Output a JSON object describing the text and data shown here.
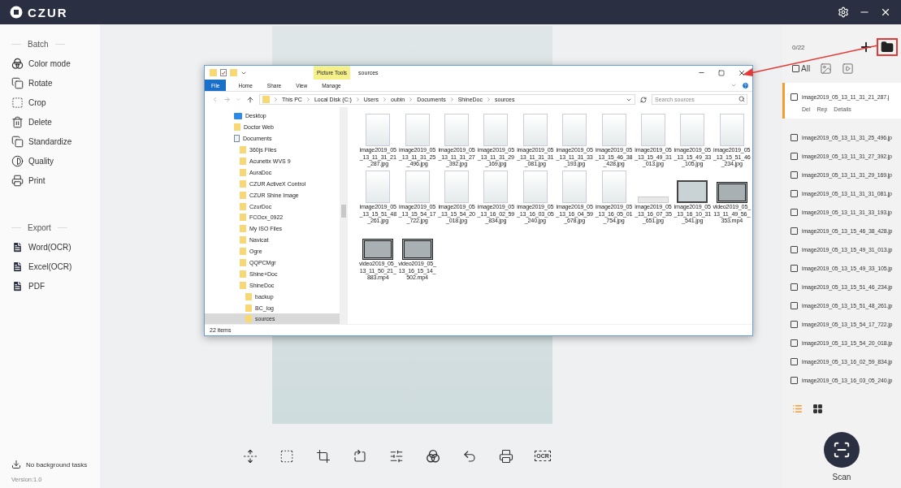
{
  "app": {
    "logo": "CZUR"
  },
  "sidebar": {
    "sections": [
      {
        "title": "Batch",
        "items": [
          {
            "kind": "color",
            "label": "Color mode"
          },
          {
            "kind": "rotate",
            "label": "Rotate"
          },
          {
            "kind": "crop",
            "label": "Crop"
          },
          {
            "kind": "delete",
            "label": "Delete"
          },
          {
            "kind": "standardize",
            "label": "Standardize"
          },
          {
            "kind": "quality",
            "label": "Quality"
          },
          {
            "kind": "print",
            "label": "Print"
          }
        ]
      },
      {
        "title": "Export",
        "items": [
          {
            "kind": "word",
            "label": "Word(OCR)"
          },
          {
            "kind": "excel",
            "label": "Excel(OCR)"
          },
          {
            "kind": "pdf",
            "label": "PDF"
          }
        ]
      }
    ],
    "status": "No background tasks",
    "version": "Version:1.0"
  },
  "toolbar": [
    {
      "kind": "fit"
    },
    {
      "kind": "select"
    },
    {
      "kind": "crop"
    },
    {
      "kind": "rotate"
    },
    {
      "kind": "adjust"
    },
    {
      "kind": "color"
    },
    {
      "kind": "undo"
    },
    {
      "kind": "print"
    },
    {
      "kind": "ocr",
      "label": "OCR"
    }
  ],
  "explorer": {
    "context_tab": "Picture Tools",
    "title": "sources",
    "ribbon": [
      {
        "label": "File",
        "selected": true
      },
      {
        "label": "Home",
        "selected": false
      },
      {
        "label": "Share",
        "selected": false
      },
      {
        "label": "View",
        "selected": false
      },
      {
        "label": "Manage",
        "selected": false
      }
    ],
    "path": [
      "This PC",
      "Local Disk (C:)",
      "Users",
      "oubin",
      "Documents",
      "ShineDoc",
      "sources"
    ],
    "search": {
      "placeholder": "Search sources"
    },
    "tree": [
      {
        "kind": "desktop",
        "label": "Desktop",
        "selected": false
      },
      {
        "kind": "folder",
        "label": "Doctor Web",
        "selected": false
      },
      {
        "kind": "documents",
        "label": "Documents",
        "selected": false,
        "children": [
          {
            "kind": "folder",
            "label": "360js Files",
            "selected": false
          },
          {
            "kind": "folder",
            "label": "Acunetix WVS 9",
            "selected": false
          },
          {
            "kind": "folder",
            "label": "AuraDoc",
            "selected": false
          },
          {
            "kind": "folder",
            "label": "CZUR ActiveX Control",
            "selected": false
          },
          {
            "kind": "folder",
            "label": "CZUR Shine Image",
            "selected": false
          },
          {
            "kind": "folder",
            "label": "CzurDoc",
            "selected": false
          },
          {
            "kind": "folder",
            "label": "FCOcx_0922",
            "selected": false
          },
          {
            "kind": "folder",
            "label": "My ISO Files",
            "selected": false
          },
          {
            "kind": "folder",
            "label": "Navicat",
            "selected": false
          },
          {
            "kind": "folder",
            "label": "Ogre",
            "selected": false
          },
          {
            "kind": "folder",
            "label": "QQPCMgr",
            "selected": false
          },
          {
            "kind": "folder",
            "label": "Shine+Doc",
            "selected": false
          },
          {
            "kind": "folder",
            "label": "ShineDoc",
            "selected": false,
            "children": [
              {
                "kind": "folder",
                "label": "backup",
                "selected": false
              },
              {
                "kind": "folder",
                "label": "BC_log",
                "selected": false
              },
              {
                "kind": "folder",
                "label": "sources",
                "selected": true
              }
            ]
          }
        ]
      }
    ],
    "files": [
      {
        "kind": "image",
        "name": "image2019_05_13_11_31_21_287.jpg"
      },
      {
        "kind": "image",
        "name": "image2019_05_13_11_31_25_496.jpg"
      },
      {
        "kind": "image",
        "name": "image2019_05_13_11_31_27_392.jpg"
      },
      {
        "kind": "image",
        "name": "image2019_05_13_11_31_29_169.jpg"
      },
      {
        "kind": "image",
        "name": "image2019_05_13_11_31_31_081.jpg"
      },
      {
        "kind": "image",
        "name": "image2019_05_13_11_31_33_193.jpg"
      },
      {
        "kind": "image",
        "name": "image2019_05_13_15_46_38_428.jpg"
      },
      {
        "kind": "image",
        "name": "image2019_05_13_15_49_31_013.jpg"
      },
      {
        "kind": "image",
        "name": "image2019_05_13_15_49_33_105.jpg"
      },
      {
        "kind": "image",
        "name": "image2019_05_13_15_51_46_234.jpg"
      },
      {
        "kind": "image",
        "name": "image2019_05_13_15_51_48_261.jpg"
      },
      {
        "kind": "image",
        "name": "image2019_05_13_15_54_17_722.jpg"
      },
      {
        "kind": "image",
        "name": "image2019_05_13_15_54_20_018.jpg"
      },
      {
        "kind": "image",
        "name": "image2019_05_13_16_02_59_834.jpg"
      },
      {
        "kind": "image",
        "name": "image2019_05_13_16_03_05_240.jpg"
      },
      {
        "kind": "image",
        "name": "image2019_05_13_16_04_59_678.jpg"
      },
      {
        "kind": "image",
        "name": "image2019_05_13_16_05_01_754.jpg"
      },
      {
        "kind": "strip",
        "name": "image2019_05_13_16_07_35_651.jpg"
      },
      {
        "kind": "wide",
        "name": "image2019_05_13_16_10_31_541.jpg"
      },
      {
        "kind": "video",
        "name": "video2019_05_13_11_49_56_353.mp4"
      },
      {
        "kind": "video",
        "name": "video2019_05_13_11_50_21_883.mp4"
      },
      {
        "kind": "video",
        "name": "video2019_05_13_16_15_14_502.mp4"
      }
    ],
    "status": "22 items"
  },
  "panel": {
    "count": "0/22",
    "folder_highlighted": true,
    "all": {
      "label": "All",
      "checked": false
    },
    "files": [
      {
        "name": "image2019_05_13_11_31_21_287.j",
        "checked": false,
        "selected": true,
        "actions": [
          "Del",
          "Rep",
          "Details"
        ]
      },
      {
        "name": "image2019_05_13_11_31_25_496.jp",
        "checked": false,
        "selected": false
      },
      {
        "name": "image2019_05_13_11_31_27_392.jp",
        "checked": false,
        "selected": false
      },
      {
        "name": "image2019_05_13_11_31_29_169.jp",
        "checked": false,
        "selected": false
      },
      {
        "name": "image2019_05_13_11_31_31_081.jp",
        "checked": false,
        "selected": false
      },
      {
        "name": "image2019_05_13_11_31_33_193.jp",
        "checked": false,
        "selected": false
      },
      {
        "name": "image2019_05_13_15_46_38_428.jp",
        "checked": false,
        "selected": false
      },
      {
        "name": "image2019_05_13_15_49_31_013.jp",
        "checked": false,
        "selected": false
      },
      {
        "name": "image2019_05_13_15_49_33_105.jp",
        "checked": false,
        "selected": false
      },
      {
        "name": "image2019_05_13_15_51_46_234.jp",
        "checked": false,
        "selected": false
      },
      {
        "name": "image2019_05_13_15_51_48_261.jp",
        "checked": false,
        "selected": false
      },
      {
        "name": "image2019_05_13_15_54_17_722.jp",
        "checked": false,
        "selected": false
      },
      {
        "name": "image2019_05_13_15_54_20_018.jp",
        "checked": false,
        "selected": false
      },
      {
        "name": "image2019_05_13_16_02_59_834.jp",
        "checked": false,
        "selected": false
      },
      {
        "name": "image2019_05_13_16_03_05_240.jp",
        "checked": false,
        "selected": false
      }
    ],
    "views": [
      {
        "kind": "list",
        "selected": true
      },
      {
        "kind": "grid",
        "selected": false
      }
    ],
    "scan": "Scan"
  }
}
